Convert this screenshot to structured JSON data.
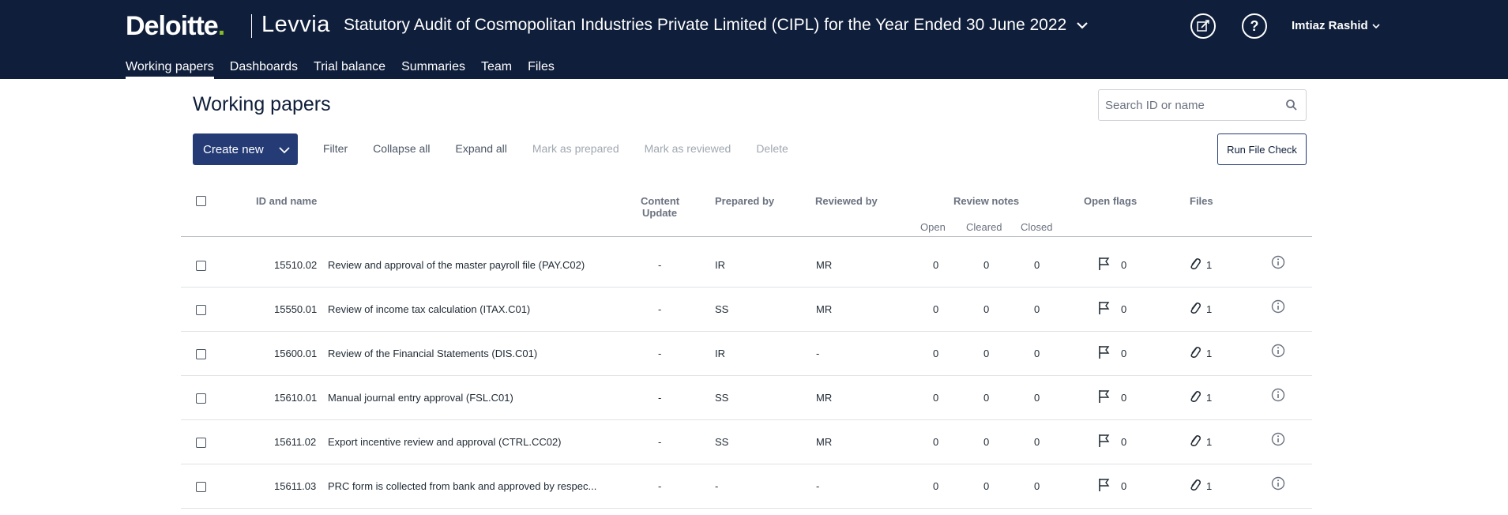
{
  "header": {
    "logo_text": "Deloitte",
    "logo_dot": ".",
    "product": "Levvia",
    "engagement_title": "Statutory Audit of Cosmopolitan Industries Private Limited (CIPL) for the Year Ended 30 June 2022",
    "user_name": "Imtiaz Rashid",
    "icons": [
      "edit-icon",
      "help-icon",
      "chevron-down-icon"
    ]
  },
  "nav": {
    "tabs": [
      {
        "label": "Working papers",
        "active": true
      },
      {
        "label": "Dashboards",
        "active": false
      },
      {
        "label": "Trial balance",
        "active": false
      },
      {
        "label": "Summaries",
        "active": false
      },
      {
        "label": "Team",
        "active": false
      },
      {
        "label": "Files",
        "active": false
      }
    ]
  },
  "page": {
    "title": "Working papers",
    "search_placeholder": "Search ID or name"
  },
  "toolbar": {
    "create_new": "Create new",
    "filter": "Filter",
    "collapse_all": "Collapse all",
    "expand_all": "Expand all",
    "mark_prepared": "Mark as prepared",
    "mark_reviewed": "Mark as reviewed",
    "delete": "Delete",
    "run_file_check": "Run File Check"
  },
  "table": {
    "columns": {
      "id_name": "ID and name",
      "content_update_1": "Content",
      "content_update_2": "Update",
      "prepared_by": "Prepared by",
      "reviewed_by": "Reviewed by",
      "review_notes": "Review notes",
      "open": "Open",
      "cleared": "Cleared",
      "closed": "Closed",
      "open_flags": "Open flags",
      "files": "Files"
    },
    "rows": [
      {
        "id": "15510.02",
        "name": "Review and approval of the master payroll file (PAY.C02)",
        "content_update": "-",
        "prepared_by": "IR",
        "reviewed_by": "MR",
        "open": "0",
        "cleared": "0",
        "closed": "0",
        "flags": "0",
        "files": "1"
      },
      {
        "id": "15550.01",
        "name": "Review of income tax calculation (ITAX.C01)",
        "content_update": "-",
        "prepared_by": "SS",
        "reviewed_by": "MR",
        "open": "0",
        "cleared": "0",
        "closed": "0",
        "flags": "0",
        "files": "1"
      },
      {
        "id": "15600.01",
        "name": "Review of the Financial Statements (DIS.C01)",
        "content_update": "-",
        "prepared_by": "IR",
        "reviewed_by": "-",
        "open": "0",
        "cleared": "0",
        "closed": "0",
        "flags": "0",
        "files": "1"
      },
      {
        "id": "15610.01",
        "name": "Manual journal entry approval (FSL.C01)",
        "content_update": "-",
        "prepared_by": "SS",
        "reviewed_by": "MR",
        "open": "0",
        "cleared": "0",
        "closed": "0",
        "flags": "0",
        "files": "1"
      },
      {
        "id": "15611.02",
        "name": "Export incentive review and approval (CTRL.CC02)",
        "content_update": "-",
        "prepared_by": "SS",
        "reviewed_by": "MR",
        "open": "0",
        "cleared": "0",
        "closed": "0",
        "flags": "0",
        "files": "1"
      },
      {
        "id": "15611.03",
        "name": "PRC form is collected from bank and approved by respec...",
        "content_update": "-",
        "prepared_by": "-",
        "reviewed_by": "-",
        "open": "0",
        "cleared": "0",
        "closed": "0",
        "flags": "0",
        "files": "1"
      }
    ]
  }
}
